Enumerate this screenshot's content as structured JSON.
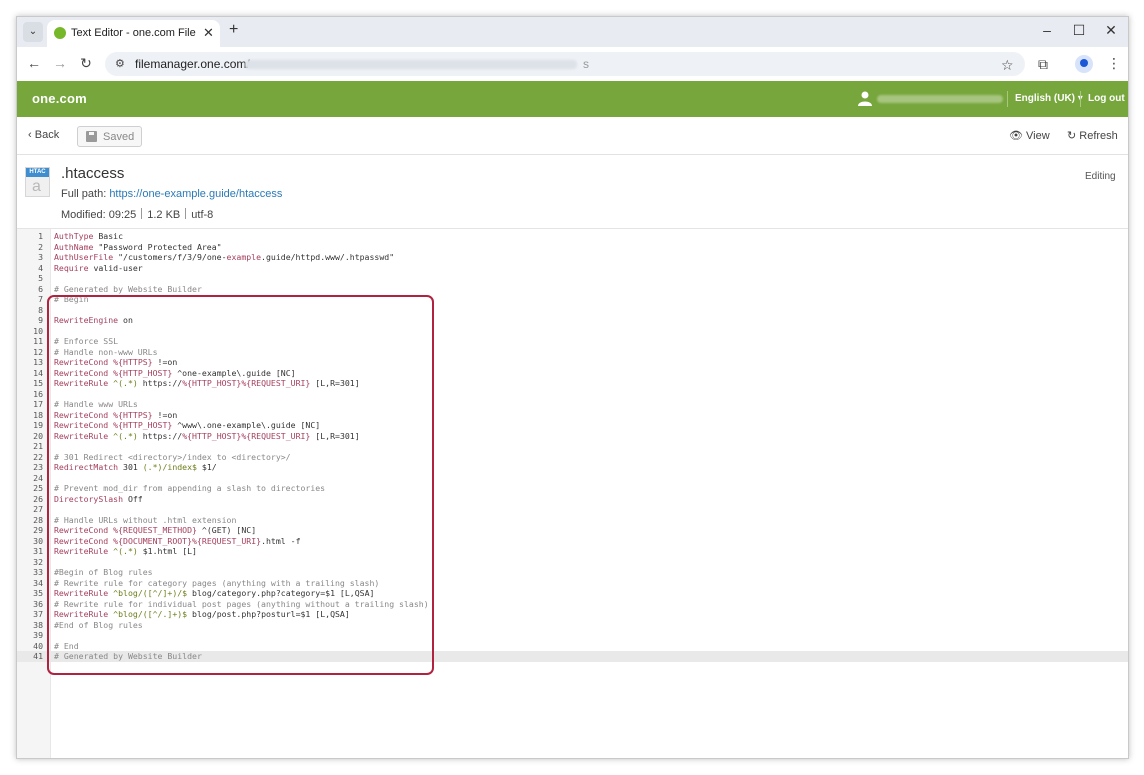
{
  "browser": {
    "tab_title": "Text Editor - one.com File Mana",
    "url_host": "filemanager.one.com/",
    "url_tail": "s"
  },
  "header": {
    "brand": "one.com",
    "language": "English (UK) ▾",
    "logout": "Log out"
  },
  "toolbar": {
    "back_label": "Back",
    "saved_label": "Saved",
    "view_label": "View",
    "refresh_label": "Refresh"
  },
  "file": {
    "icon_badge": "HTAC",
    "name": ".htaccess",
    "full_path_label": "Full path: ",
    "full_path": "https://one-example.guide/htaccess",
    "modified_label": "Modified:",
    "modified_time": "09:25",
    "size": "1.2 KB",
    "encoding": "utf-8",
    "status": "Editing"
  },
  "editor": {
    "active_line": 41,
    "lines": [
      [
        [
          "kw",
          "AuthType"
        ],
        [
          "str",
          " Basic"
        ]
      ],
      [
        [
          "kw",
          "AuthName"
        ],
        [
          "str",
          " \"Password Protected Area\""
        ]
      ],
      [
        [
          "kw",
          "AuthUserFile"
        ],
        [
          "str",
          " \"/customers/f/3/9/one-"
        ],
        [
          "kw",
          "example"
        ],
        [
          "str",
          ".guide/httpd.www/.htpasswd\""
        ]
      ],
      [
        [
          "kw",
          "Require"
        ],
        [
          "str",
          " valid-user"
        ]
      ],
      [],
      [
        [
          "cm",
          "# Generated by Website Builder"
        ]
      ],
      [
        [
          "cm",
          "# Begin"
        ]
      ],
      [],
      [
        [
          "kw",
          "RewriteEngine"
        ],
        [
          "str",
          " on"
        ]
      ],
      [],
      [
        [
          "cm",
          "# Enforce SSL"
        ]
      ],
      [
        [
          "cm",
          "# Handle non-www URLs"
        ]
      ],
      [
        [
          "kw",
          "RewriteCond"
        ],
        [
          "str",
          " "
        ],
        [
          "var",
          "%{HTTPS}"
        ],
        [
          "str",
          " !=on"
        ]
      ],
      [
        [
          "kw",
          "RewriteCond"
        ],
        [
          "str",
          " "
        ],
        [
          "var",
          "%{HTTP_HOST}"
        ],
        [
          "str",
          " ^one-example\\.guide [NC]"
        ]
      ],
      [
        [
          "kw",
          "RewriteRule"
        ],
        [
          "str",
          " "
        ],
        [
          "fl",
          "^(.*)"
        ],
        [
          "str",
          " https://"
        ],
        [
          "var",
          "%{HTTP_HOST}%{REQUEST_URI}"
        ],
        [
          "str",
          " [L,R=301]"
        ]
      ],
      [],
      [
        [
          "cm",
          "# Handle www URLs"
        ]
      ],
      [
        [
          "kw",
          "RewriteCond"
        ],
        [
          "str",
          " "
        ],
        [
          "var",
          "%{HTTPS}"
        ],
        [
          "str",
          " !=on"
        ]
      ],
      [
        [
          "kw",
          "RewriteCond"
        ],
        [
          "str",
          " "
        ],
        [
          "var",
          "%{HTTP_HOST}"
        ],
        [
          "str",
          " ^www\\.one-example\\.guide [NC]"
        ]
      ],
      [
        [
          "kw",
          "RewriteRule"
        ],
        [
          "str",
          " "
        ],
        [
          "fl",
          "^(.*)"
        ],
        [
          "str",
          " https://"
        ],
        [
          "var",
          "%{HTTP_HOST}%{REQUEST_URI}"
        ],
        [
          "str",
          " [L,R=301]"
        ]
      ],
      [],
      [
        [
          "cm",
          "# 301 Redirect <directory>/index to <directory>/"
        ]
      ],
      [
        [
          "kw",
          "RedirectMatch"
        ],
        [
          "str",
          " 301 "
        ],
        [
          "fl",
          "(.*)/index$"
        ],
        [
          "str",
          " $1/"
        ]
      ],
      [],
      [
        [
          "cm",
          "# Prevent mod_dir from appending a slash to directories"
        ]
      ],
      [
        [
          "kw",
          "DirectorySlash"
        ],
        [
          "str",
          " Off"
        ]
      ],
      [],
      [
        [
          "cm",
          "# Handle URLs without .html extension"
        ]
      ],
      [
        [
          "kw",
          "RewriteCond"
        ],
        [
          "str",
          " "
        ],
        [
          "var",
          "%{REQUEST_METHOD}"
        ],
        [
          "str",
          " ^(GET) [NC]"
        ]
      ],
      [
        [
          "kw",
          "RewriteCond"
        ],
        [
          "str",
          " "
        ],
        [
          "var",
          "%{DOCUMENT_ROOT}%{REQUEST_URI}"
        ],
        [
          "str",
          ".html -f"
        ]
      ],
      [
        [
          "kw",
          "RewriteRule"
        ],
        [
          "str",
          " "
        ],
        [
          "fl",
          "^(.*)"
        ],
        [
          "str",
          " $1.html [L]"
        ]
      ],
      [],
      [
        [
          "cm",
          "#Begin of Blog rules"
        ]
      ],
      [
        [
          "cm",
          "# Rewrite rule for category pages (anything with a trailing slash)"
        ]
      ],
      [
        [
          "kw",
          "RewriteRule"
        ],
        [
          "str",
          " "
        ],
        [
          "fl",
          "^blog/([^/]+)/$"
        ],
        [
          "str",
          " blog/category.php?category=$1 [L,QSA]"
        ]
      ],
      [
        [
          "cm",
          "# Rewrite rule for individual post pages (anything without a trailing slash)"
        ]
      ],
      [
        [
          "kw",
          "RewriteRule"
        ],
        [
          "str",
          " "
        ],
        [
          "fl",
          "^blog/([^/.]+)$"
        ],
        [
          "str",
          " blog/post.php?posturl=$1 [L,QSA]"
        ]
      ],
      [
        [
          "cm",
          "#End of Blog rules"
        ]
      ],
      [],
      [
        [
          "cm",
          "# End"
        ]
      ],
      [
        [
          "cm",
          "# Generated by Website Builder"
        ]
      ]
    ]
  },
  "icons": {
    "tab_menu": "chevron-down-icon",
    "close": "close-icon",
    "new_tab": "plus-icon",
    "back": "arrow-left-icon",
    "forward": "arrow-right-icon",
    "reload": "reload-icon",
    "bookmark": "star-icon",
    "extensions": "puzzle-icon",
    "menu": "kebab-icon"
  },
  "colors": {
    "brand_green": "#76a63c",
    "highlight_border": "#b0223f",
    "link": "#2a7ab8"
  }
}
